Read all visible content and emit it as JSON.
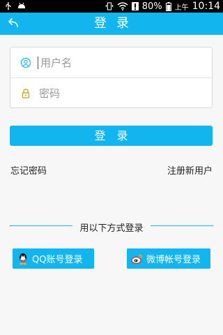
{
  "status_bar": {
    "battery_percent": "80%",
    "ampm": "上午",
    "time": "10:14",
    "icons": [
      "usb-icon",
      "android-debug-icon",
      "vibrate-icon",
      "wifi-icon",
      "alert-icon",
      "battery-icon"
    ]
  },
  "header": {
    "title": "登录",
    "back_icon": "back-arrow-icon"
  },
  "form": {
    "username_placeholder": "用户名",
    "password_placeholder": "密码",
    "username_icon": "user-icon",
    "password_icon": "lock-icon"
  },
  "actions": {
    "login_label": "登录",
    "forgot_password": "忘记密码",
    "register": "注册新用户"
  },
  "social": {
    "divider_text": "用以下方式登录",
    "qq_label": "QQ账号登录",
    "weibo_label": "微博帐号登录",
    "qq_icon": "qq-icon",
    "weibo_icon": "weibo-icon"
  },
  "colors": {
    "accent": "#13b5ef",
    "background": "#f7f7f7"
  }
}
